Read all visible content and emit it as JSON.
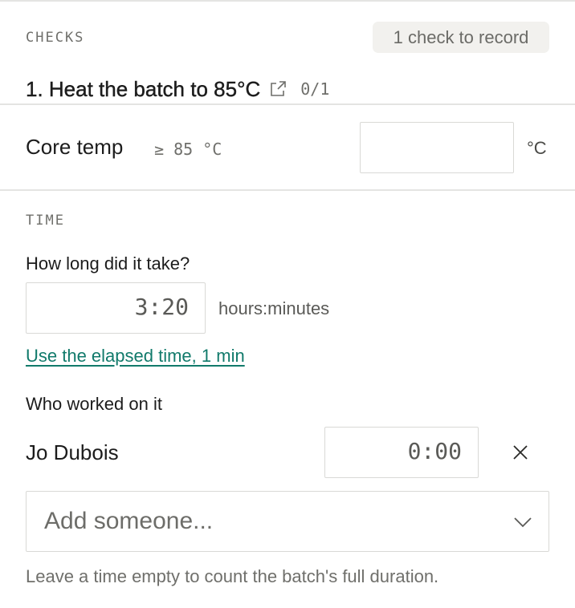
{
  "checks": {
    "section_label": "CHECKS",
    "badge": "1 check to record",
    "step": {
      "title": "1. Heat the batch to 85°C",
      "link_icon": "external-link-icon",
      "count": "0/1"
    },
    "fields": [
      {
        "label": "Core temp",
        "requirement": "≥ 85 °C",
        "value": "",
        "unit": "°C"
      }
    ]
  },
  "time": {
    "section_label": "TIME",
    "question": "How long did it take?",
    "duration_value": "3:20",
    "duration_unit": "hours:minutes",
    "use_elapsed_link": "Use the elapsed time, 1 min",
    "workers_label": "Who worked on it",
    "workers": [
      {
        "name": "Jo Dubois",
        "time": "0:00",
        "remove_icon": "close-icon"
      }
    ],
    "add_placeholder": "Add someone...",
    "add_icon": "chevron-down-icon",
    "footnote": "Leave a time empty to count the batch's full duration."
  },
  "colors": {
    "link": "#117a6b",
    "border": "#d9d9d6",
    "divider": "#e4e4e2",
    "badge_bg": "#f2f1ee"
  }
}
